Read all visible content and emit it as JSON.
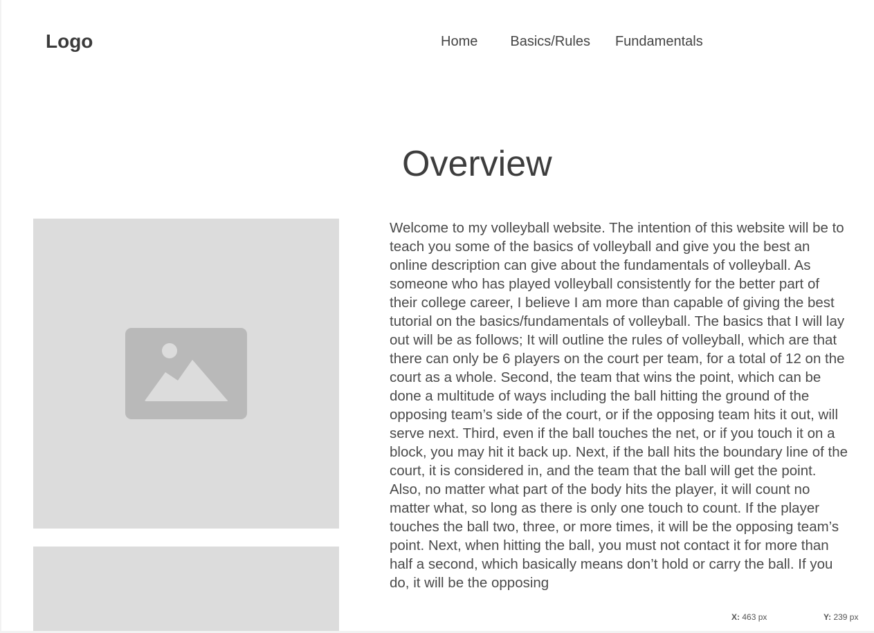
{
  "header": {
    "logo": "Logo",
    "nav": [
      "Home",
      "Basics/Rules",
      "Fundamentals"
    ]
  },
  "main": {
    "title": "Overview",
    "body": "Welcome to my volleyball website. The intention of this website will be to teach you some of the basics of volleyball and give you the best an online description can give about the fundamentals of volleyball. As someone who has played volleyball consistently for the better part of their college career, I believe I am more than capable of giving the best tutorial on the basics/fundamentals of volleyball. The basics that I will lay out will be as follows; It will outline the rules of volleyball, which are that there can only be 6 players on the court per team, for a total of 12 on the court as a whole. Second, the team that wins the point, which can be done a multitude of ways including the ball hitting the ground of the opposing team’s side of the court, or if the opposing team hits it out, will serve next. Third, even if the ball touches the net, or if you touch it on a block, you may hit it back up. Next, if the ball hits the boundary line of the court, it is considered in, and the team that the ball will get the point. Also, no matter what part of the body hits the player, it will count no matter what, so long as there is only one touch to count. If the player touches the ball two, three, or more times, it will be the opposing team’s point. Next, when hitting the ball, you must not contact it for more than half a second, which basically means don’t hold or carry the ball. If you do, it will be the opposing"
  },
  "coords": {
    "x_label": "X:",
    "x_value": "463 px",
    "y_label": "Y:",
    "y_value": "239 px"
  },
  "icons": {
    "image_placeholder": "image-placeholder-icon"
  },
  "colors": {
    "placeholder_bg": "#dcdcdc",
    "placeholder_icon": "#b9b9b9",
    "text": "#4a4a4a"
  }
}
